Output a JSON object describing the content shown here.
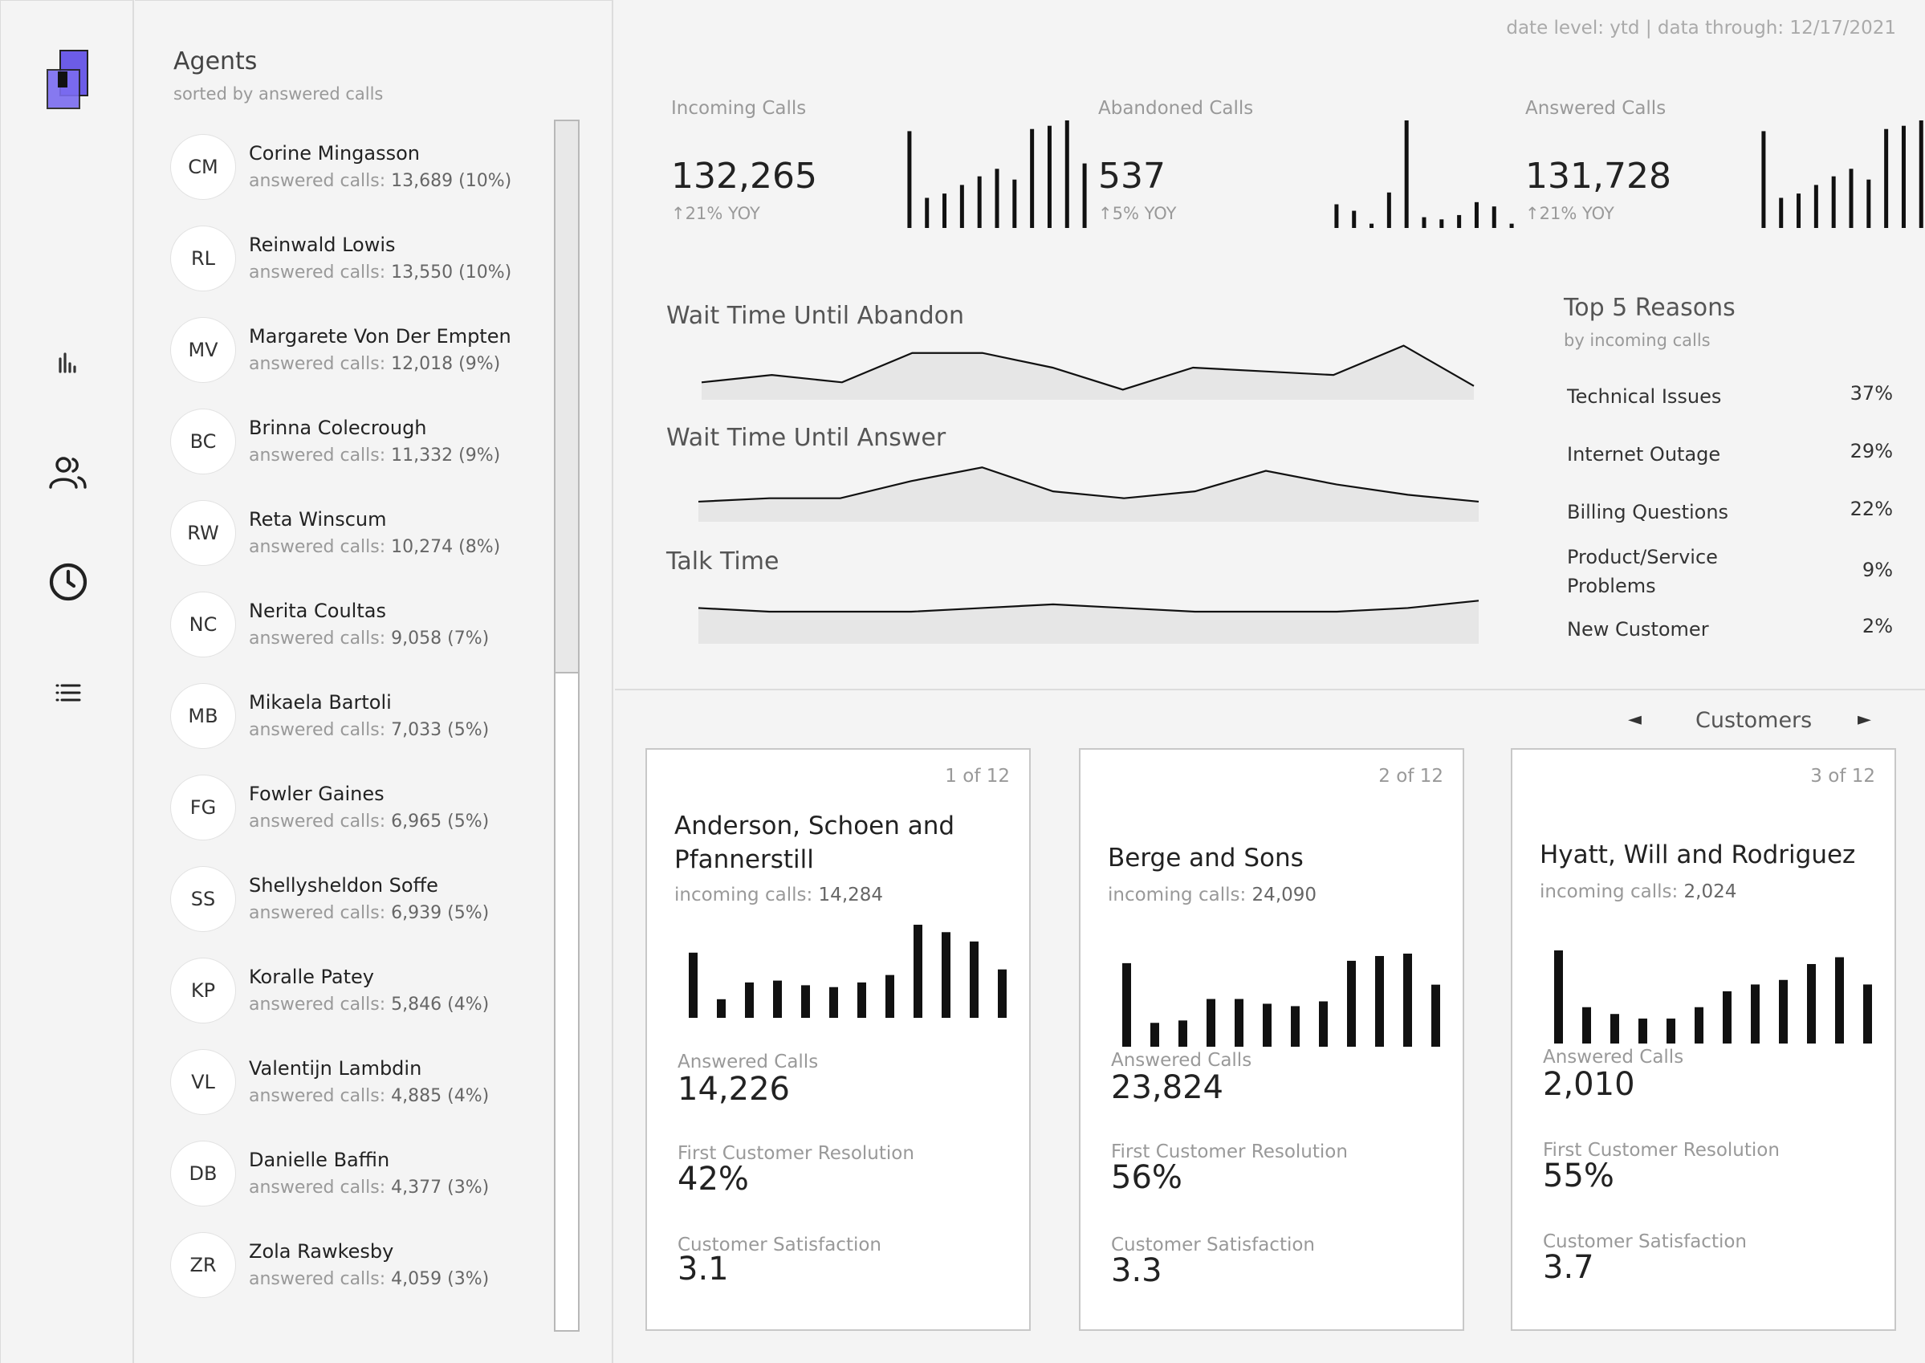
{
  "header": {
    "date_info": "date level: ytd | data through: 12/17/2021"
  },
  "nav": {
    "icons": [
      "logo-icon",
      "bar-chart-icon",
      "users-icon",
      "clock-icon",
      "list-icon"
    ],
    "accent": "#6c5ce7"
  },
  "agents": {
    "title": "Agents",
    "subtitle": "sorted by answered calls",
    "stat_label": "answered calls:",
    "items": [
      {
        "initials": "CM",
        "name": "Corine Mingasson",
        "stat": "13,689 (10%)"
      },
      {
        "initials": "RL",
        "name": "Reinwald Lowis",
        "stat": "13,550 (10%)"
      },
      {
        "initials": "MV",
        "name": "Margarete Von Der Empten",
        "stat": "12,018 (9%)"
      },
      {
        "initials": "BC",
        "name": "Brinna Colecrough",
        "stat": "11,332 (9%)"
      },
      {
        "initials": "RW",
        "name": "Reta Winscum",
        "stat": "10,274 (8%)"
      },
      {
        "initials": "NC",
        "name": "Nerita Coultas",
        "stat": "9,058 (7%)"
      },
      {
        "initials": "MB",
        "name": "Mikaela Bartoli",
        "stat": "7,033 (5%)"
      },
      {
        "initials": "FG",
        "name": "Fowler Gaines",
        "stat": "6,965 (5%)"
      },
      {
        "initials": "SS",
        "name": "Shellysheldon Soffe",
        "stat": "6,939 (5%)"
      },
      {
        "initials": "KP",
        "name": "Koralle Patey",
        "stat": "5,846 (4%)"
      },
      {
        "initials": "VL",
        "name": "Valentijn Lambdin",
        "stat": "4,885 (4%)"
      },
      {
        "initials": "DB",
        "name": "Danielle Baffin",
        "stat": "4,377 (3%)"
      },
      {
        "initials": "ZR",
        "name": "Zola Rawkesby",
        "stat": "4,059 (3%)"
      }
    ]
  },
  "kpis": [
    {
      "label": "Incoming Calls",
      "value": "132,265",
      "yoy": "↑21% YOY"
    },
    {
      "label": "Abandoned Calls",
      "value": "537",
      "yoy": "↑5% YOY"
    },
    {
      "label": "Answered Calls",
      "value": "131,728",
      "yoy": "↑21% YOY"
    }
  ],
  "areas": {
    "abandon_title": "Wait Time Until Abandon",
    "answer_title": "Wait Time Until Answer",
    "talk_title": "Talk Time"
  },
  "reasons": {
    "title": "Top 5 Reasons",
    "subtitle": "by incoming calls",
    "items": [
      {
        "label": "Technical Issues",
        "pct": "37%"
      },
      {
        "label": "Internet Outage",
        "pct": "29%"
      },
      {
        "label": "Billing Questions",
        "pct": "22%"
      },
      {
        "label": "Product/Service Problems",
        "pct": "9%"
      },
      {
        "label": "New Customer",
        "pct": "2%"
      }
    ]
  },
  "customers": {
    "label": "Customers",
    "prev_icon": "◄",
    "next_icon": "►",
    "incoming_label": "incoming calls:",
    "answered_label": "Answered Calls",
    "fcr_label": "First Customer Resolution",
    "csat_label": "Customer Satisfaction",
    "cards": [
      {
        "index": "1 of 12",
        "name": "Anderson, Schoen and Pfannerstill",
        "incoming": "14,284",
        "answered": "14,226",
        "fcr": "42%",
        "csat": "3.1"
      },
      {
        "index": "2 of 12",
        "name": "Berge and Sons",
        "incoming": "24,090",
        "answered": "23,824",
        "fcr": "56%",
        "csat": "3.3"
      },
      {
        "index": "3 of 12",
        "name": "Hyatt, Will and Rodriguez",
        "incoming": "2,024",
        "answered": "2,010",
        "fcr": "55%",
        "csat": "3.7"
      }
    ]
  },
  "chart_data": [
    {
      "type": "bar",
      "series": [
        {
          "values": [
            90,
            28,
            32,
            40,
            48,
            55,
            45,
            92,
            95,
            100,
            60
          ]
        }
      ]
    },
    {
      "type": "bar",
      "series": [
        {
          "values": [
            22,
            16,
            4,
            33,
            100,
            10,
            8,
            12,
            24,
            20,
            4
          ]
        }
      ]
    },
    {
      "type": "bar",
      "series": [
        {
          "values": [
            90,
            28,
            32,
            40,
            48,
            55,
            45,
            92,
            95,
            100,
            60
          ]
        }
      ]
    },
    {
      "type": "area",
      "series": [
        {
          "values": [
            3,
            5,
            3,
            11,
            11,
            7,
            1,
            7,
            6,
            5,
            13,
            2
          ]
        }
      ]
    },
    {
      "type": "area",
      "series": [
        {
          "values": [
            4,
            5,
            5,
            10,
            14,
            7,
            5,
            7,
            13,
            9,
            6,
            4
          ]
        }
      ]
    },
    {
      "type": "area",
      "series": [
        {
          "values": [
            8,
            7,
            7,
            7,
            8,
            9,
            8,
            7,
            7,
            7,
            8,
            10
          ]
        }
      ]
    },
    {
      "type": "bar",
      "series": [
        {
          "values": [
            70,
            20,
            38,
            40,
            35,
            33,
            38,
            46,
            100,
            92,
            82,
            52
          ]
        }
      ]
    },
    {
      "type": "bar",
      "series": [
        {
          "values": [
            70,
            20,
            22,
            40,
            40,
            36,
            34,
            38,
            72,
            76,
            78,
            52
          ]
        }
      ]
    },
    {
      "type": "bar",
      "series": [
        {
          "values": [
            82,
            32,
            26,
            22,
            22,
            32,
            46,
            52,
            56,
            70,
            76,
            52
          ]
        }
      ]
    }
  ]
}
